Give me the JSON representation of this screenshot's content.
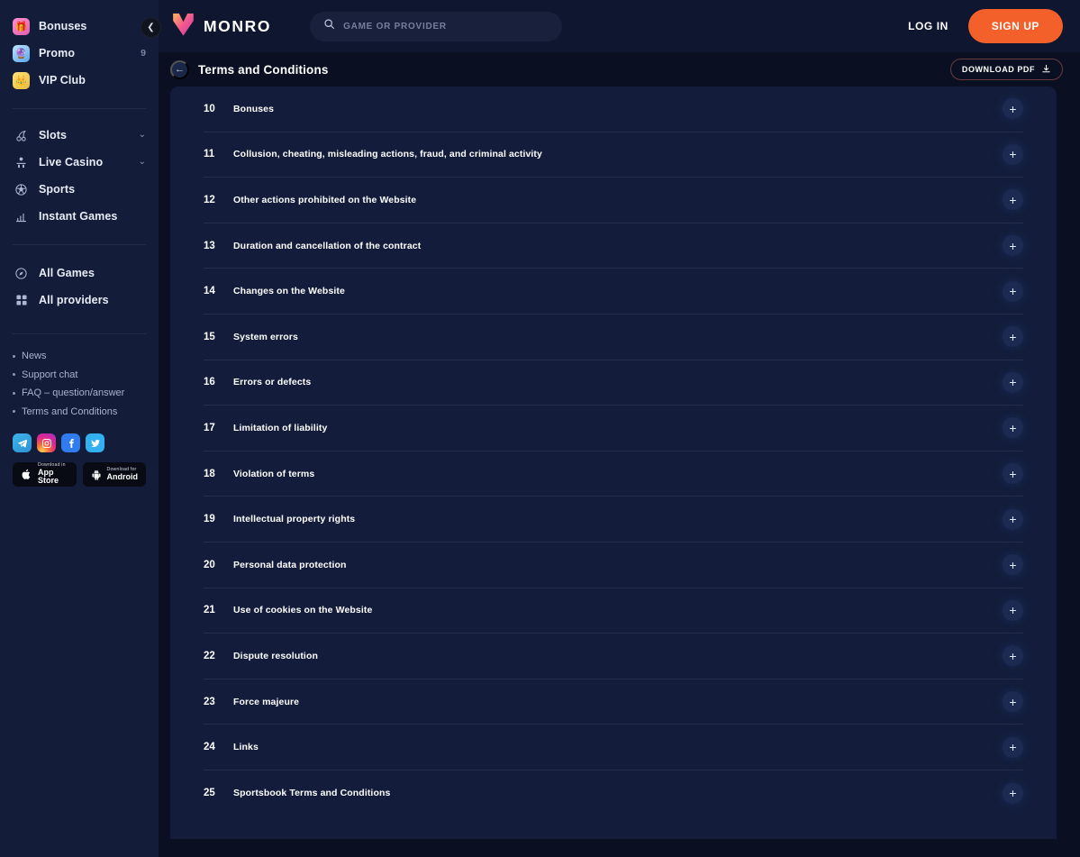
{
  "brand": {
    "name": "MONRO",
    "logo_icon": "monro-v-logo"
  },
  "search": {
    "placeholder": "GAME OR PROVIDER",
    "icon": "search-icon"
  },
  "auth": {
    "login_label": "LOG IN",
    "signup_label": "SIGN UP",
    "accent_color": "#f4602a"
  },
  "sidebar": {
    "collapse_icon": "chevron-left-icon",
    "promo_group": [
      {
        "label": "Bonuses",
        "icon": "gift-icon",
        "badge": ""
      },
      {
        "label": "Promo",
        "icon": "promo-icon",
        "badge": "9"
      },
      {
        "label": "VIP Club",
        "icon": "crown-icon",
        "badge": ""
      }
    ],
    "games_group": [
      {
        "label": "Slots",
        "icon": "cherry-icon",
        "chevron": "⌄"
      },
      {
        "label": "Live Casino",
        "icon": "live-casino-icon",
        "chevron": "⌄"
      },
      {
        "label": "Sports",
        "icon": "soccer-ball-icon",
        "chevron": ""
      },
      {
        "label": "Instant Games",
        "icon": "instant-games-icon",
        "chevron": ""
      }
    ],
    "browse_group": [
      {
        "label": "All Games",
        "icon": "compass-icon"
      },
      {
        "label": "All providers",
        "icon": "grid-icon"
      }
    ],
    "footer_links": [
      {
        "label": "News"
      },
      {
        "label": "Support chat"
      },
      {
        "label": "FAQ – question/answer"
      },
      {
        "label": "Terms and Conditions"
      }
    ],
    "socials": [
      {
        "name": "telegram-icon",
        "color": "#2a92d6"
      },
      {
        "name": "instagram-icon",
        "color": "#e0268f"
      },
      {
        "name": "facebook-icon",
        "color": "#2f7bef"
      },
      {
        "name": "twitter-icon",
        "color": "#33b0ef"
      }
    ],
    "stores": [
      {
        "top": "Download in",
        "name": "App Store",
        "icon": "apple-icon"
      },
      {
        "top": "Download for",
        "name": "Android",
        "icon": "android-icon"
      }
    ]
  },
  "page": {
    "title": "Terms and Conditions",
    "back_icon": "arrow-left-icon",
    "download_label": "DOWNLOAD PDF",
    "download_icon": "download-icon"
  },
  "terms": {
    "expand_icon": "plus-icon",
    "rows": [
      {
        "num": "10",
        "title": "Bonuses"
      },
      {
        "num": "11",
        "title": "Collusion, cheating, misleading actions, fraud, and criminal activity"
      },
      {
        "num": "12",
        "title": "Other actions prohibited on the Website"
      },
      {
        "num": "13",
        "title": "Duration and cancellation of the contract"
      },
      {
        "num": "14",
        "title": "Changes on the Website"
      },
      {
        "num": "15",
        "title": "System errors"
      },
      {
        "num": "16",
        "title": "Errors or defects"
      },
      {
        "num": "17",
        "title": "Limitation of liability"
      },
      {
        "num": "18",
        "title": "Violation of terms"
      },
      {
        "num": "19",
        "title": "Intellectual property rights"
      },
      {
        "num": "20",
        "title": "Personal data protection"
      },
      {
        "num": "21",
        "title": "Use of cookies on the Website"
      },
      {
        "num": "22",
        "title": "Dispute resolution"
      },
      {
        "num": "23",
        "title": "Force majeure"
      },
      {
        "num": "24",
        "title": "Links"
      },
      {
        "num": "25",
        "title": "Sportsbook Terms and Conditions"
      }
    ]
  }
}
